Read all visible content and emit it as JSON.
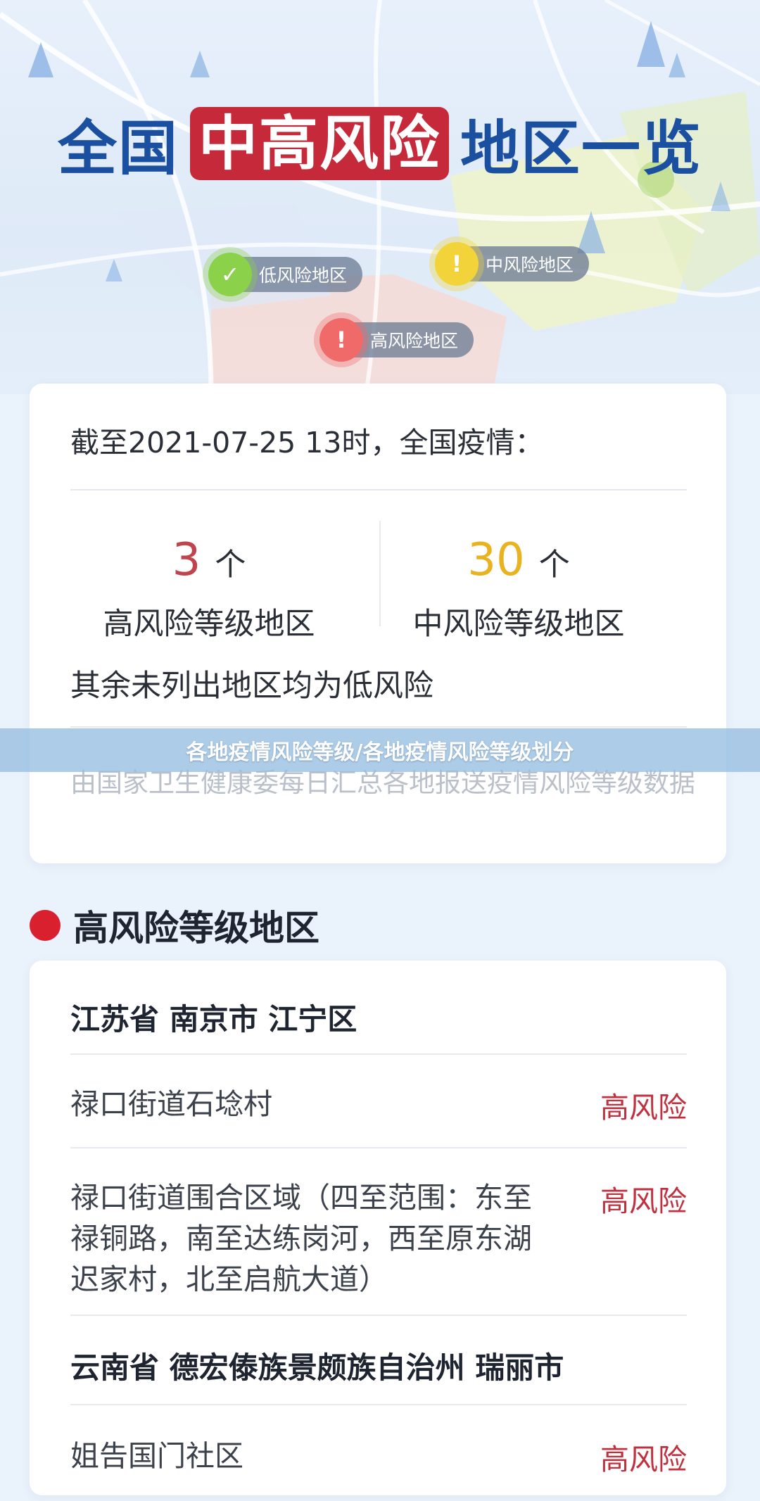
{
  "header": {
    "title_prefix": "全国",
    "title_highlight": "中高风险",
    "title_suffix": "地区一览",
    "legend": {
      "low": {
        "label": "低风险地区",
        "icon": "check-icon",
        "color": "#8bd14a"
      },
      "mid": {
        "label": "中风险地区",
        "icon": "exclamation-icon",
        "color": "#f2d43a"
      },
      "high": {
        "label": "高风险地区",
        "icon": "exclamation-icon",
        "color": "#f06a6a"
      }
    }
  },
  "summary": {
    "as_of": "截至2021-07-25 13时，全国疫情：",
    "high": {
      "count": "3",
      "unit": "个",
      "label": "高风险等级地区",
      "color": "#c0444e"
    },
    "mid": {
      "count": "30",
      "unit": "个",
      "label": "中风险等级地区",
      "color": "#e9b320"
    },
    "rest_note": "其余未列出地区均为低风险",
    "source_note": "由国家卫生健康委每日汇总各地报送疫情风险等级数据"
  },
  "banner": {
    "text": "各地疫情风险等级/各地疫情风险等级划分"
  },
  "high_risk_section": {
    "title": "高风险等级地区",
    "dot_color": "#d8202f",
    "regions": [
      {
        "name": "江苏省 南京市 江宁区",
        "areas": [
          {
            "name": "禄口街道石埝村",
            "risk": "高风险"
          },
          {
            "name": "禄口街道围合区域（四至范围：东至禄铜路，南至达练岗河，西至原东湖迟家村，北至启航大道）",
            "risk": "高风险"
          }
        ]
      },
      {
        "name": "云南省 德宏傣族景颇族自治州 瑞丽市",
        "areas": [
          {
            "name": "姐告国门社区",
            "risk": "高风险"
          }
        ]
      }
    ]
  }
}
